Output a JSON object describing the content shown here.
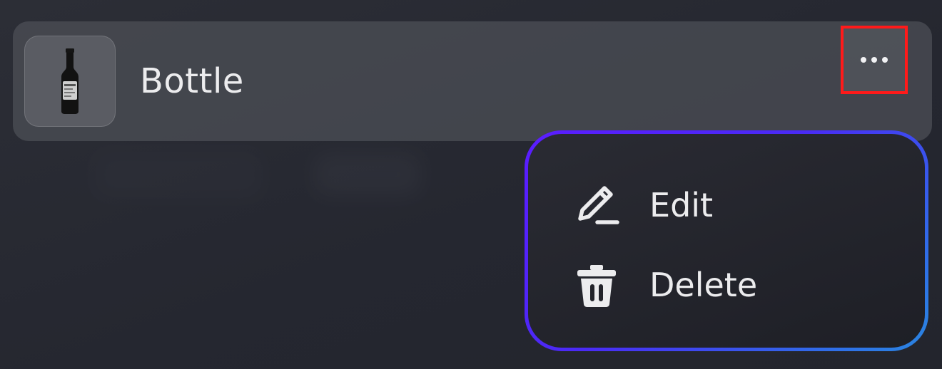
{
  "item": {
    "name": "Bottle",
    "thumbnail_icon": "bottle-icon"
  },
  "more_button": {
    "icon": "more-horizontal-icon",
    "highlight_color": "#ff1a1a"
  },
  "context_menu": {
    "border_gradient": [
      "#5b1cff",
      "#2a86e0"
    ],
    "items": [
      {
        "label": "Edit",
        "icon": "pencil-icon"
      },
      {
        "label": "Delete",
        "icon": "trash-icon"
      }
    ]
  }
}
